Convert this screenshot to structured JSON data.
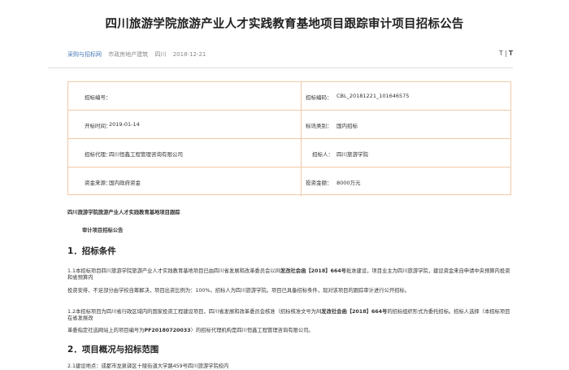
{
  "header": {
    "title": "四川旅游学院旅游产业人才实践教育基地项目跟踪审计项目招标公告",
    "source": "采购与招标网",
    "category": "市政房地产建筑",
    "region": "四川",
    "date": "2018-12-21",
    "font_small": "T",
    "font_sep": "|",
    "font_big": "T"
  },
  "info": {
    "bid_no_label": "招标编号：",
    "bid_no_value": "",
    "code_label": "招标编码：",
    "code_value": "CBL_20181221_101646575",
    "open_label": "开标时间：",
    "open_value": "2019-01-14",
    "type_label": "标讯类别：",
    "type_value": "国内招标",
    "agent_label": "招标代理：",
    "agent_value": "四川恒鑫工程管理咨询有限公司",
    "tenderee_label": "招标人：",
    "tenderee_value": "四川旅游学院",
    "fund_label": "资金来源：",
    "fund_value": "国内政府资金",
    "invest_label": "投资金额：",
    "invest_value": "8000万元"
  },
  "content": {
    "project_line1": "四川旅游学院旅游产业人才实践教育基地项目跟踪",
    "project_line2": "审计项目招标公告",
    "section1": "1．招标条件",
    "p1_a": "1.1本招标项目四川旅游学院旅游产业人才实践教育基地项目已由四川省发展和改革委员会以",
    "p1_b": "川发改社会函【2018】664号",
    "p1_c": "批准建设，项目业主为",
    "p1_d": "四川旅游学院",
    "p1_e": "，建设资金来自申请中央预算内投资和省预算内",
    "p1_line2": "投资安排、不足部分由学校自筹解决，项目出资比例为：100%，招标人为四川旅游学院。项目已具备招标条件，现对该项目的跟踪审计进行公开招标。",
    "p2_a": "1.2本招标项目为四川省行政区域内的国家投资工程建设项目，四川省发展和改革委员会核准（招标核准文号为",
    "p2_b": "川发改社会函【2018】664号",
    "p2_c": "的招标组织形式为",
    "p2_d": "委托招标",
    "p2_e": "。招标人选择（本招标项目在省发展改",
    "p2_line2_a": "革委指定社选网站上的项目编号为",
    "p2_line2_b": "PF20180720033",
    "p2_line2_c": "）的招标代理机构是四川恒鑫工程管理咨询有限公司。",
    "section2": "2．项目概况与招标范围",
    "p3": "2.1建设地点：成都市龙泉驿区十陵街道大学路459号四川旅游学院校内"
  }
}
